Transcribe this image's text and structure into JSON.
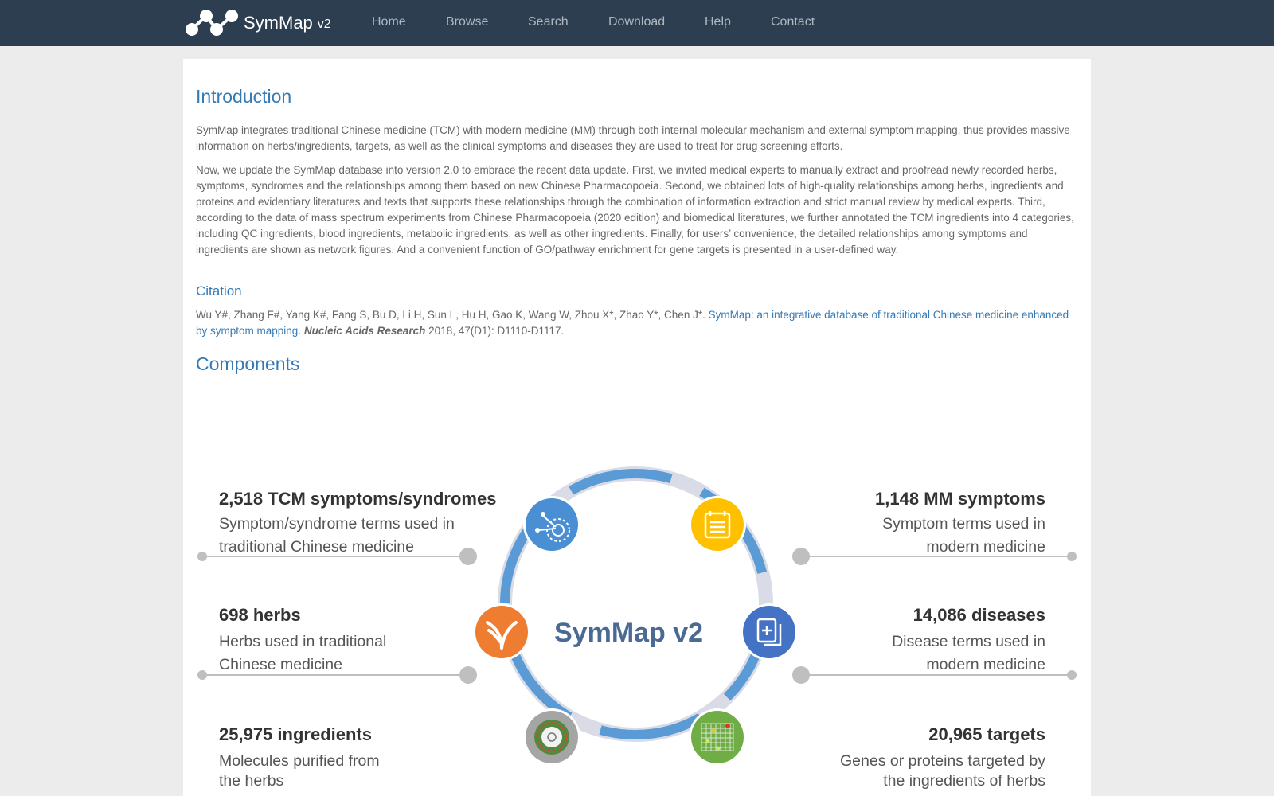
{
  "brand": {
    "name": "SymMap",
    "version": "v2",
    "logo": "symmap-logo-icon"
  },
  "nav": [
    "Home",
    "Browse",
    "Search",
    "Download",
    "Help",
    "Contact"
  ],
  "intro": {
    "heading": "Introduction",
    "p1": "SymMap integrates traditional Chinese medicine (TCM) with modern medicine (MM) through both internal molecular mechanism and external symptom mapping, thus provides massive information on herbs/ingredients, targets, as well as the clinical symptoms and diseases they are used to treat for drug screening efforts.",
    "p2": "Now, we update the SymMap database into version 2.0 to embrace the recent data update. First, we invited medical experts to manually extract and proofread newly recorded herbs, symptoms, syndromes and the relationships among them based on new Chinese Pharmacopoeia. Second, we obtained lots of high-quality relationships among herbs, ingredients and proteins and evidentiary literatures and texts that supports these relationships through the combination of information extraction and strict manual review by medical experts. Third, according to the data of mass spectrum experiments from Chinese Pharmacopoeia (2020 edition) and biomedical literatures, we further annotated the TCM ingredients into 4 categories, including QC ingredients, blood ingredients, metabolic ingredients, as well as other ingredients. Finally, for users’ convenience, the detailed relationships among symptoms and ingredients are shown as network figures. And a convenient function of GO/pathway enrichment for gene targets is presented in a user-defined way."
  },
  "citation": {
    "heading": "Citation",
    "authors": "Wu Y#, Zhang F#, Yang K#, Fang S, Bu D, Li H, Sun L, Hu H, Gao K, Wang W, Zhou X*, Zhao Y*, Chen J*.",
    "title_link": "SymMap: an integrative database of traditional Chinese medicine enhanced by symptom mapping",
    "journal": "Nucleic Acids Research",
    "details": "2018, 47(D1): D1110-D1117."
  },
  "components": {
    "heading": "Components",
    "center": "SymMap v2",
    "items": [
      {
        "title": "2,518 TCM symptoms/syndromes",
        "desc1": "Symptom/syndrome terms used in",
        "desc2": "traditional Chinese medicine",
        "color": "#4a8fd4",
        "icon": "network-icon"
      },
      {
        "title": "698 herbs",
        "desc1": "Herbs used in traditional",
        "desc2": "Chinese medicine",
        "color": "#ee7d31",
        "icon": "herb-sprout-icon"
      },
      {
        "title": "25,975 ingredients",
        "desc1": "Molecules purified from",
        "desc2": "the herbs",
        "color": "#a5a5a5",
        "icon": "molecule-ring-icon"
      },
      {
        "title": "1,148 MM symptoms",
        "desc1": "Symptom terms used in",
        "desc2": "modern medicine",
        "color": "#ffc000",
        "icon": "clipboard-list-icon"
      },
      {
        "title": "14,086 diseases",
        "desc1": "Disease terms used in",
        "desc2": "modern medicine",
        "color": "#4472c4",
        "icon": "medical-documents-icon"
      },
      {
        "title": "20,965 targets",
        "desc1": "Genes or proteins targeted by",
        "desc2": "the ingredients of herbs",
        "color": "#70ad47",
        "icon": "heatmap-grid-icon"
      }
    ]
  }
}
